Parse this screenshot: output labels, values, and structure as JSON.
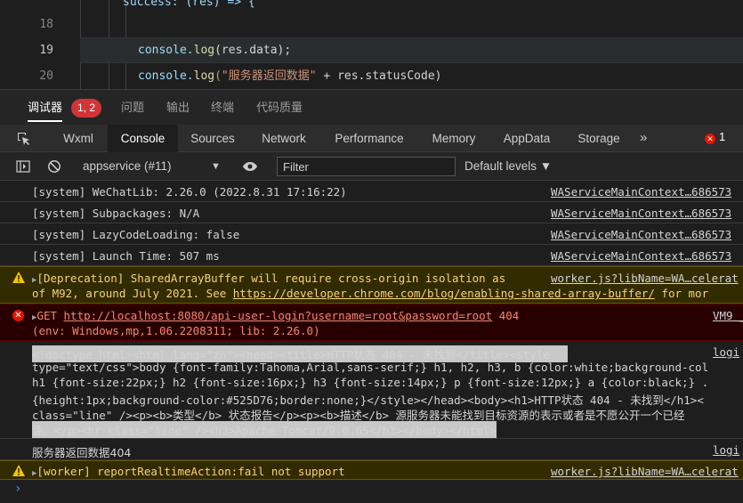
{
  "editor": {
    "lines": [
      {
        "num": "18",
        "code": ""
      },
      {
        "num": "19",
        "code_prefix": "console.",
        "code_fn": "log",
        "code_args": "(res.data);"
      },
      {
        "num": "20",
        "code_prefix": "console.",
        "code_fn": "log",
        "code_str": "(\"服务器返回数据\"",
        "code_rest": " + res.statusCode)"
      }
    ],
    "top_partial": "success: (res) => {"
  },
  "panel_tabs": {
    "items": [
      "调试器",
      "问题",
      "输出",
      "终端",
      "代码质量"
    ],
    "badge": "1, 2"
  },
  "devtools_tabs": {
    "items": [
      "Wxml",
      "Console",
      "Sources",
      "Network",
      "Performance",
      "Memory",
      "AppData",
      "Storage"
    ],
    "more": "»",
    "error_count": "1",
    "error_glyph": "✕"
  },
  "toolbar": {
    "context": "appservice (#11)",
    "caret": "▼",
    "filter_placeholder": "Filter",
    "levels": "Default levels ▼"
  },
  "console": {
    "system_rows": [
      {
        "msg": "[system] WeChatLib: 2.26.0 (2022.8.31 17:16:22)",
        "src": "WAServiceMainContext…686573"
      },
      {
        "msg": "[system] Subpackages: N/A",
        "src": "WAServiceMainContext…686573"
      },
      {
        "msg": "[system] LazyCodeLoading: false",
        "src": "WAServiceMainContext…686573"
      },
      {
        "msg": "[system] Launch Time: 507 ms",
        "src": "WAServiceMainContext…686573"
      }
    ],
    "deprecation": {
      "line1": "[Deprecation] SharedArrayBuffer will require cross-origin isolation as",
      "line2_prefix": "of M92, around July 2021. See ",
      "line2_link": "https://developer.chrome.com/blog/enabling-shared-array-buffer/",
      "line2_suffix": " for mor",
      "src": "worker.js?libName=WA…celerat"
    },
    "error_get": {
      "method": "GET ",
      "url": "http://localhost:8080/api-user-login?username=root&password=root",
      "status": " 404",
      "env": "(env: Windows,mp,1.06.2208311; lib: 2.26.0)",
      "src": "VM9 _"
    },
    "html_lines": [
      "<!doctype html><html lang=\"zh\"><head><title>HTTP状态 404 - 未找到</title><style",
      "type=\"text/css\">body {font-family:Tahoma,Arial,sans-serif;} h1, h2, h3, b {color:white;background-col",
      "h1 {font-size:22px;} h2 {font-size:16px;} h3 {font-size:14px;} p {font-size:12px;} a {color:black;} .",
      "{height:1px;background-color:#525D76;border:none;}</style></head><body><h1>HTTP状态 404 - 未找到</h1><",
      "class=\"line\" /><p><b>类型</b> 状态报告</p><p><b>描述</b> 源服务器未能找到目标资源的表示或者是不愿公开一个已经",
      "源。</p><hr class=\"line\" /><h3>Apache Tomcat/9.0.65</h3></body></html>"
    ],
    "html_src": "logi",
    "server_msg": "服务器返回数据404",
    "server_src": "logi",
    "worker_warn": "[worker] reportRealtimeAction:fail not support",
    "worker_src": "worker.js?libName=WA…celerat",
    "prompt": "›"
  },
  "colors": {
    "accent_error": "#e51400",
    "warn_bg": "#332b00",
    "error_bg": "#290000"
  }
}
